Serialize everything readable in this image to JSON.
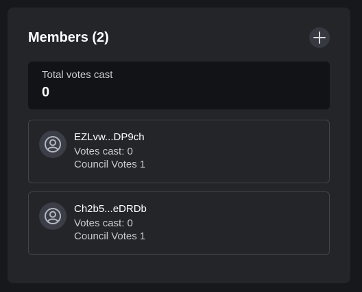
{
  "header": {
    "title": "Members (2)",
    "add_icon": "plus-icon"
  },
  "summary": {
    "label": "Total votes cast",
    "value": "0"
  },
  "members": [
    {
      "name": "EZLvw...DP9ch",
      "votes_cast": "Votes cast: 0",
      "council_votes": "Council Votes 1",
      "avatar_icon": "user-circle-icon"
    },
    {
      "name": "Ch2b5...eDRDb",
      "votes_cast": "Votes cast: 0",
      "council_votes": "Council Votes 1",
      "avatar_icon": "user-circle-icon"
    }
  ]
}
